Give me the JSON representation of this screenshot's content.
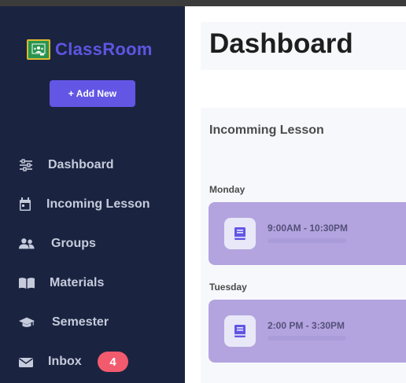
{
  "sidebar": {
    "brand": "ClassRoom",
    "add_button": "+ Add New",
    "nav": [
      {
        "label": "Dashboard",
        "icon": "sliders-icon"
      },
      {
        "label": "Incoming Lesson",
        "icon": "calendar-icon"
      },
      {
        "label": "Groups",
        "icon": "users-icon"
      },
      {
        "label": "Materials",
        "icon": "book-open-icon"
      },
      {
        "label": "Semester",
        "icon": "graduation-cap-icon"
      },
      {
        "label": "Inbox",
        "icon": "envelope-icon",
        "badge": "4"
      }
    ]
  },
  "main": {
    "title": "Dashboard",
    "panel_title": "Incomming Lesson",
    "days": [
      {
        "day": "Monday",
        "lessons": [
          {
            "time": "9:00AM - 10:30PM",
            "icon": "book-icon"
          }
        ]
      },
      {
        "day": "Tuesday",
        "lessons": [
          {
            "time": "2:00 PM - 3:30PM",
            "icon": "book-icon"
          }
        ]
      }
    ]
  },
  "colors": {
    "sidebar_bg": "#1a2440",
    "accent": "#6356e5",
    "brand_text": "#5f55e2",
    "card_bg": "#b3a4df",
    "badge_bg": "#f25b6d",
    "nav_text": "#c6cbdc"
  }
}
